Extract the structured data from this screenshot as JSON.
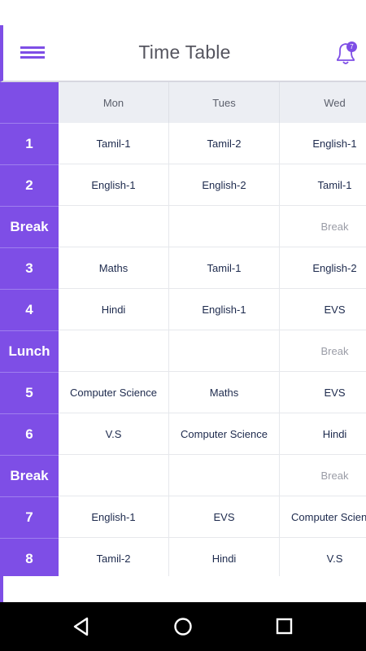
{
  "header": {
    "title": "Time Table",
    "notification_count": "7"
  },
  "colors": {
    "accent": "#7e4ee6",
    "text_dark": "#1d2a4d",
    "muted": "#9a9ca6"
  },
  "days": [
    "Mon",
    "Tues",
    "Wed"
  ],
  "rows": [
    {
      "label": "1",
      "cells": [
        "Tamil-1",
        "Tamil-2",
        "English-1"
      ]
    },
    {
      "label": "2",
      "cells": [
        "English-1",
        "English-2",
        "Tamil-1"
      ]
    },
    {
      "label": "Break",
      "cells": [
        "",
        "",
        "Break"
      ]
    },
    {
      "label": "3",
      "cells": [
        "Maths",
        "Tamil-1",
        "English-2"
      ]
    },
    {
      "label": "4",
      "cells": [
        "Hindi",
        "English-1",
        "EVS"
      ]
    },
    {
      "label": "Lunch",
      "cells": [
        "",
        "",
        "Break"
      ]
    },
    {
      "label": "5",
      "cells": [
        "Computer Science",
        "Maths",
        "EVS"
      ]
    },
    {
      "label": "6",
      "cells": [
        "V.S",
        "Computer Science",
        "Hindi"
      ]
    },
    {
      "label": "Break",
      "cells": [
        "",
        "",
        "Break"
      ]
    },
    {
      "label": "7",
      "cells": [
        "English-1",
        "EVS",
        "Computer Science"
      ]
    },
    {
      "label": "8",
      "cells": [
        "Tamil-2",
        "Hindi",
        "V.S"
      ]
    }
  ],
  "icons": {
    "menu": "hamburger-menu-icon",
    "bell": "bell-icon",
    "back": "nav-back-icon",
    "home": "nav-home-icon",
    "recents": "nav-recents-icon"
  }
}
